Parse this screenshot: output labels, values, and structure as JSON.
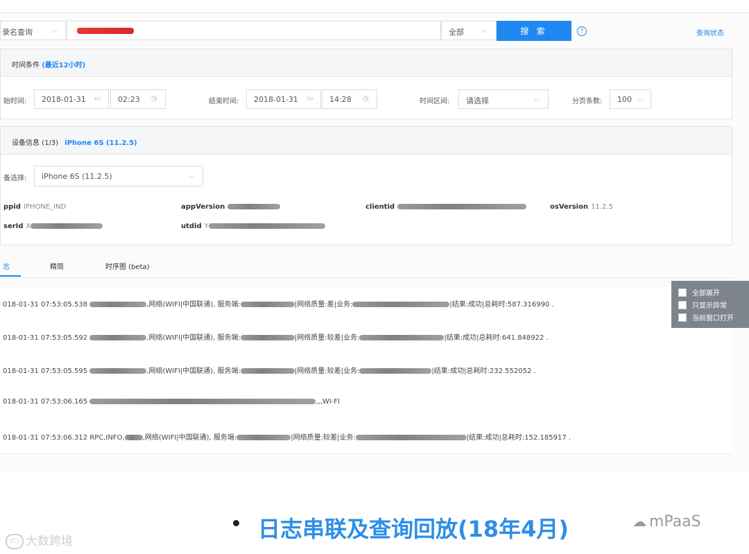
{
  "search": {
    "type_select": "录名查询",
    "scope_select": "全部",
    "button": "搜 索",
    "help_icon": "?",
    "status_link": "查询状态"
  },
  "time_panel": {
    "title": "时间条件",
    "title_accent": "(最近12小时)",
    "start_label": "始时间:",
    "start_date": "2018-01-31",
    "start_time": "02:23",
    "end_label": "结束时间:",
    "end_date": "2018-01-31",
    "end_time": "14:28",
    "range_label": "时间区间:",
    "range_placeholder": "请选择",
    "page_size_label": "分页条数:",
    "page_size": "100"
  },
  "device_panel": {
    "title": "设备信息 (1/3)",
    "title_accent": "iPhone 6S (11.2.5)",
    "select_label": "备选择:",
    "select_value": "iPhone 6S (11.2.5)",
    "fields": {
      "appid_label": "ppid",
      "appid_value": "IPHONE_IND",
      "appversion_label": "appVersion",
      "clientid_label": "clientid",
      "osversion_label": "osVersion",
      "osversion_value": "11.2.5",
      "userid_label": "serId",
      "userid_prefix": "X",
      "utdid_label": "utdid",
      "utdid_prefix": "Y"
    }
  },
  "tabs": [
    {
      "label": "志"
    },
    {
      "label": "精简"
    },
    {
      "label": "时序图 (beta)"
    }
  ],
  "logs": [
    {
      "ts": "018-01-31 07:53:05.538",
      "network": ",网络(WIFI|中国联通), 服务端:",
      "quality": "|网络质量:差|业务:",
      "result": "|结果:成功|总耗时:587.316990 ."
    },
    {
      "ts": "018-01-31 07:53:05.592",
      "network": ",网络(WIFI|中国联通), 服务端:",
      "quality": "|网络质量:较差|业务:",
      "result": "|结果:成功|总耗时:641.848922 ."
    },
    {
      "ts": "018-01-31 07:53:05.595",
      "network": ",网络(WIFI|中国联通), 服务端:",
      "quality": "|网络质量:较差|业务:",
      "result": "|结果:成功|总耗时:232.552052 ."
    },
    {
      "ts": "018-01-31 07:53:06.165",
      "network": "",
      "quality": "",
      "result": ",,,WI-FI"
    },
    {
      "ts": "018-01-31 07:53:06.312",
      "prefix": "RPC,INFO,",
      "network": ",网络(WIFI|中国联通), 服务端:",
      "quality": "|网络质量:较差|业务:",
      "result": "|结果:成功|总耗时:152.185917 ."
    }
  ],
  "options": {
    "expand_all": "全部展开",
    "only_errors": "只显示异常",
    "open_current": "当前窗口打开"
  },
  "caption": "日志串联及查询回放(18年4月)",
  "watermark_left": "大数跨境",
  "watermark_left_badge": "(C)",
  "watermark_right": "mPaaS"
}
